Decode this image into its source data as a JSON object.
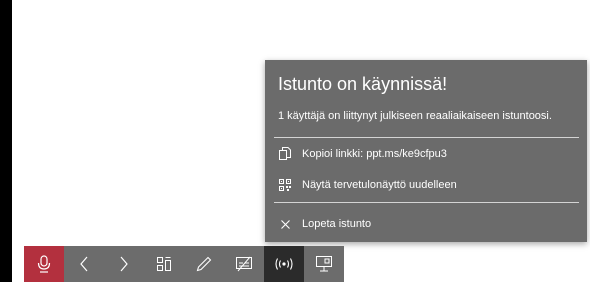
{
  "popup": {
    "title": "Istunto on käynnissä!",
    "status": "1 käyttäjä on liittynyt julkiseen reaaliaikaiseen istuntoosi.",
    "items": [
      {
        "label": "Kopioi linkki: ppt.ms/ke9cfpu3",
        "icon": "copy-icon"
      },
      {
        "label": "Näytä tervetulonäyttö uudelleen",
        "icon": "qr-code-icon"
      },
      {
        "label": "Lopeta istunto",
        "icon": "close-icon"
      }
    ]
  },
  "toolbar": {
    "buttons": [
      {
        "name": "microphone-button",
        "icon": "microphone-icon",
        "active": true
      },
      {
        "name": "previous-slide-button",
        "icon": "chevron-left-icon"
      },
      {
        "name": "next-slide-button",
        "icon": "chevron-right-icon"
      },
      {
        "name": "see-all-slides-button",
        "icon": "slides-grid-icon"
      },
      {
        "name": "pen-button",
        "icon": "pen-icon"
      },
      {
        "name": "subtitles-button",
        "icon": "subtitles-icon"
      },
      {
        "name": "live-presentation-button",
        "icon": "broadcast-icon",
        "selected": true
      },
      {
        "name": "presenter-options-button",
        "icon": "presenter-screen-icon"
      }
    ]
  },
  "colors": {
    "popup_bg": "#6b6b6b",
    "toolbar_bg": "#6c6c6c",
    "mic_active": "#b3303e",
    "live_selected": "#2b2b2b",
    "text": "#ffffff"
  }
}
